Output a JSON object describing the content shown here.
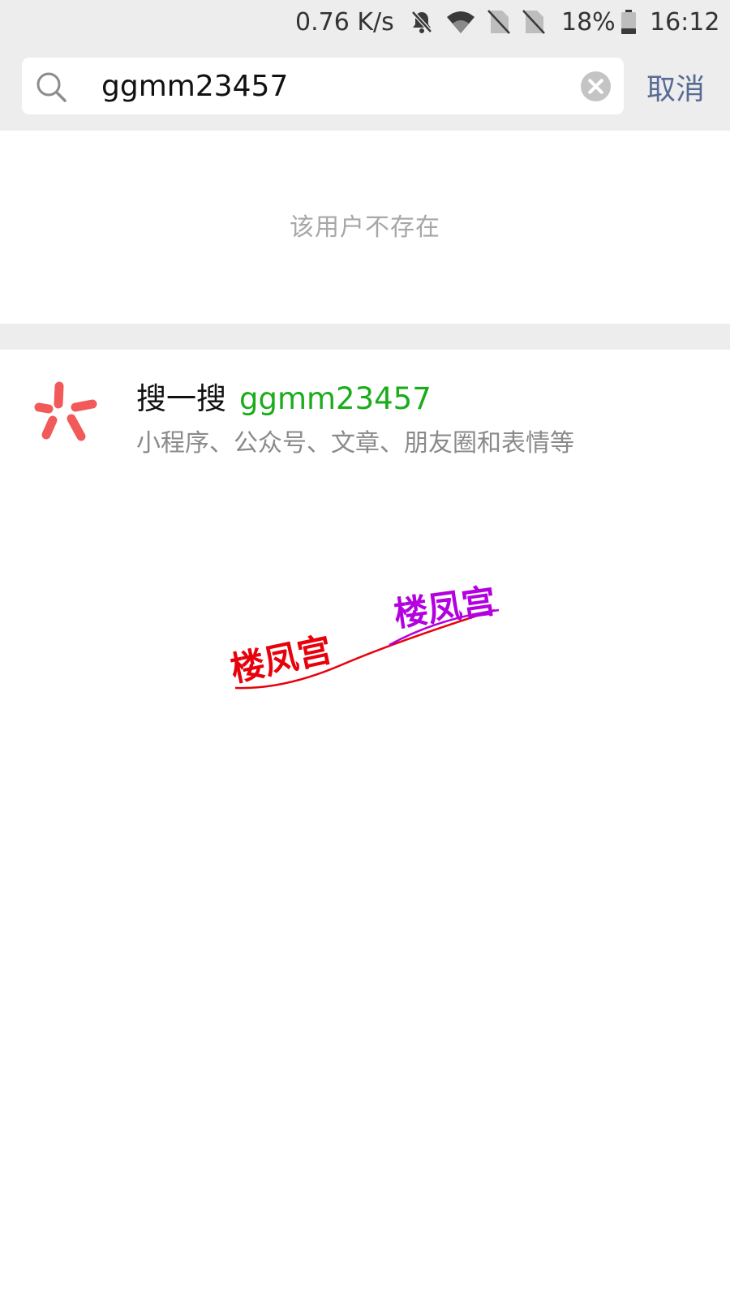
{
  "status_bar": {
    "network_speed": "0.76 K/s",
    "battery_percent": "18%",
    "time": "16:12",
    "icons": [
      "mute-bell-icon",
      "wifi-icon",
      "no-sim-icon",
      "no-sim-icon",
      "battery-icon"
    ]
  },
  "search": {
    "query": "ggmm23457",
    "cancel_label": "取消",
    "icon": "search-icon",
    "clear_icon": "clear-icon"
  },
  "results": {
    "not_found_message": "该用户不存在"
  },
  "souyisou": {
    "prefix": "搜一搜",
    "keyword": "ggmm23457",
    "subtitle": "小程序、公众号、文章、朋友圈和表情等",
    "icon": "souyisou-icon",
    "icon_color": "#f25a5a"
  },
  "watermark": {
    "text_left": "楼凤宫",
    "text_right": "楼凤宫",
    "color_left": "#e8000b",
    "color_right": "#b400e0"
  },
  "colors": {
    "header_bg": "#ededed",
    "link_blue": "#576b95",
    "accent_green": "#1aad19",
    "muted_text": "#a7a7a7"
  }
}
